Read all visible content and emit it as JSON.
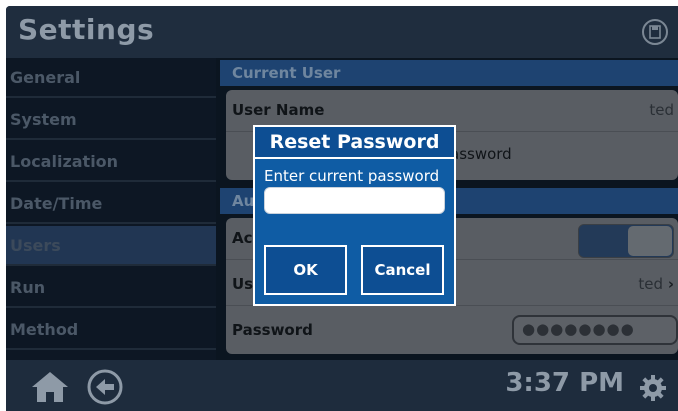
{
  "header": {
    "title": "Settings",
    "save_icon": "save-icon"
  },
  "sidebar": {
    "items": [
      {
        "label": "General"
      },
      {
        "label": "System"
      },
      {
        "label": "Localization"
      },
      {
        "label": "Date/Time"
      },
      {
        "label": "Users",
        "active": true
      },
      {
        "label": "Run"
      },
      {
        "label": "Method"
      }
    ]
  },
  "content": {
    "current_user": {
      "header": "Current User",
      "user_name_label": "User Name",
      "user_name_value": "ted",
      "change_password_partial": "assword"
    },
    "auth": {
      "header_partial": "Au",
      "row1_partial": "Ac",
      "row2_partial": "Us",
      "row2_value": "ted",
      "row2_chevron": "›",
      "password_label": "Password",
      "password_dots": "●●●●●●●●"
    }
  },
  "dialog": {
    "title": "Reset Password",
    "prompt": "Enter current password",
    "input_value": "",
    "ok_label": "OK",
    "cancel_label": "Cancel"
  },
  "footer": {
    "time": "3:37 PM"
  },
  "colors": {
    "dialog_bg": "#0f5ca4",
    "section_header": "#1e4371",
    "toggle_on": "#233a58"
  }
}
